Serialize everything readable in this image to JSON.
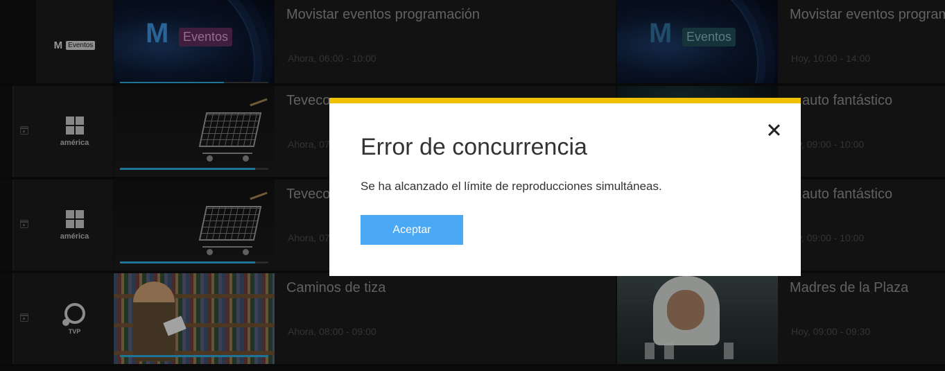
{
  "guide": {
    "rows": [
      {
        "channel_logo": "movistar-eventos-logo",
        "logo_m": "M",
        "logo_text": "Eventos",
        "current_program": {
          "title": "Movistar eventos programación",
          "time": "Ahora, 06:00 - 10:00",
          "progress": 0.7
        },
        "next_program": {
          "title": "Movistar eventos program",
          "time": "Hoy, 10:00 - 14:00"
        }
      },
      {
        "channel_logo": "america-logo",
        "logo_text": "américa",
        "current_program": {
          "title": "Teveco",
          "time": "Ahora, 07",
          "progress": 0.91
        },
        "next_program": {
          "title": "auto fantástico",
          "time": "y, 09:00 - 10:00"
        }
      },
      {
        "channel_logo": "america-logo",
        "logo_text": "américa",
        "current_program": {
          "title": "Teveco",
          "time": "Ahora, 07",
          "progress": 0.91
        },
        "next_program": {
          "title": "auto fantástico",
          "time": "y, 09:00 - 10:00"
        }
      },
      {
        "channel_logo": "tvp-logo",
        "logo_text": "TVP",
        "current_program": {
          "title": "Caminos de tiza",
          "time": "Ahora, 08:00 - 09:00",
          "progress": 1.0
        },
        "next_program": {
          "title": "Madres de la Plaza",
          "time": "Hoy, 09:00 - 09:30"
        }
      }
    ]
  },
  "dialog": {
    "title": "Error de concurrencia",
    "message": "Se ha alcanzado el límite de reproducciones simultáneas.",
    "accept_label": "Aceptar",
    "accent_color": "#eec000",
    "button_color": "#4aa8f4"
  }
}
